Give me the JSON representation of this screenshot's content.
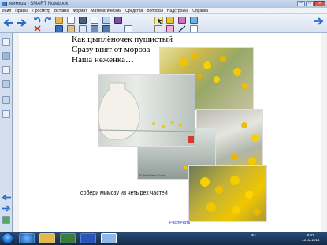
{
  "window": {
    "title": "мимоза - SMART Notebook",
    "controls": [
      "–",
      "□",
      "✕"
    ]
  },
  "menu": [
    "Файл",
    "Правка",
    "Просмотр",
    "Вставка",
    "Формат",
    "Математический",
    "Средства",
    "Вопросы",
    "Надстройки",
    "Справка"
  ],
  "page": {
    "poem": [
      "Как цыплёночек пушистый",
      "Сразу внят от мороза",
      "Наша неженка…"
    ],
    "instruction": "собери мимозу из четырех частей",
    "reset_link": "Распечать",
    "watermark": "© Фотобанк Лори"
  },
  "taskbar": {
    "lang": "RU",
    "time": "8:47",
    "date": "12.02.2014"
  },
  "colors": {
    "titlebar": "#aec6e4",
    "accent": "#3a7bd5",
    "taskbar": "#142b4a",
    "mimosa": "#f2c600"
  }
}
